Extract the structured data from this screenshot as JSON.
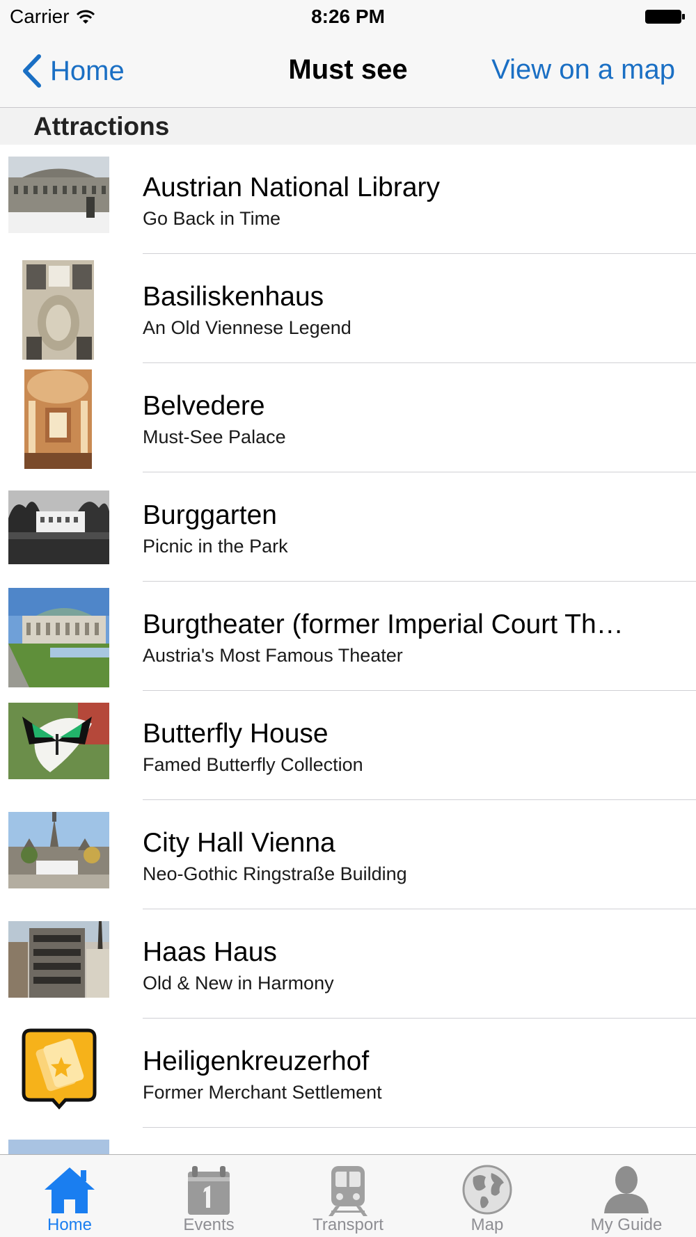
{
  "status_bar": {
    "carrier": "Carrier",
    "time": "8:26 PM"
  },
  "nav": {
    "back_label": "Home",
    "title": "Must see",
    "map_label": "View on a map"
  },
  "section": {
    "header": "Attractions"
  },
  "items": [
    {
      "title": "Austrian National Library",
      "subtitle": "Go Back in Time"
    },
    {
      "title": "Basiliskenhaus",
      "subtitle": "An Old Viennese Legend"
    },
    {
      "title": "Belvedere",
      "subtitle": "Must-See Palace"
    },
    {
      "title": "Burggarten",
      "subtitle": "Picnic in the Park"
    },
    {
      "title": "Burgtheater (former Imperial Court Th…",
      "subtitle": "Austria's Most Famous Theater"
    },
    {
      "title": "Butterfly House",
      "subtitle": "Famed Butterfly Collection"
    },
    {
      "title": "City Hall Vienna",
      "subtitle": "Neo-Gothic Ringstraße Building"
    },
    {
      "title": "Haas Haus",
      "subtitle": "Old & New in Harmony"
    },
    {
      "title": "Heiligenkreuzerhof",
      "subtitle": "Former Merchant Settlement"
    }
  ],
  "tabs": [
    {
      "label": "Home",
      "icon": "house-icon",
      "active": true
    },
    {
      "label": "Events",
      "icon": "calendar-icon",
      "active": false
    },
    {
      "label": "Transport",
      "icon": "train-icon",
      "active": false
    },
    {
      "label": "Map",
      "icon": "globe-icon",
      "active": false
    },
    {
      "label": "My Guide",
      "icon": "person-icon",
      "active": false
    }
  ],
  "colors": {
    "accent": "#1a6fc4",
    "tab_active": "#1a7ef0",
    "tab_inactive": "#8e8e93"
  }
}
